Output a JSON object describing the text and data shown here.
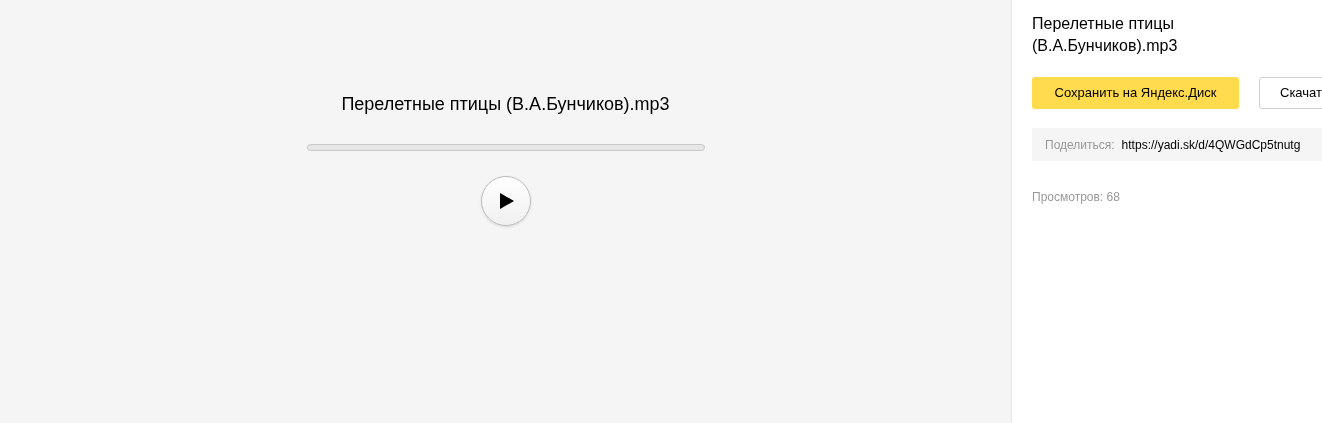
{
  "player": {
    "title": "Перелетные птицы (В.А.Бунчиков).mp3",
    "progress": {
      "level": 0
    },
    "playing": false
  },
  "sidebar": {
    "title": "Перелетные птицы (В.А.Бунчиков).mp3",
    "save_button": "Сохранить на Яндекс.Диск",
    "download_button": "Скачат",
    "share_label": "Поделиться:",
    "share_link": "https://yadi.sk/d/4QWGdCp5tnutg",
    "views": "Просмотров: 68"
  }
}
